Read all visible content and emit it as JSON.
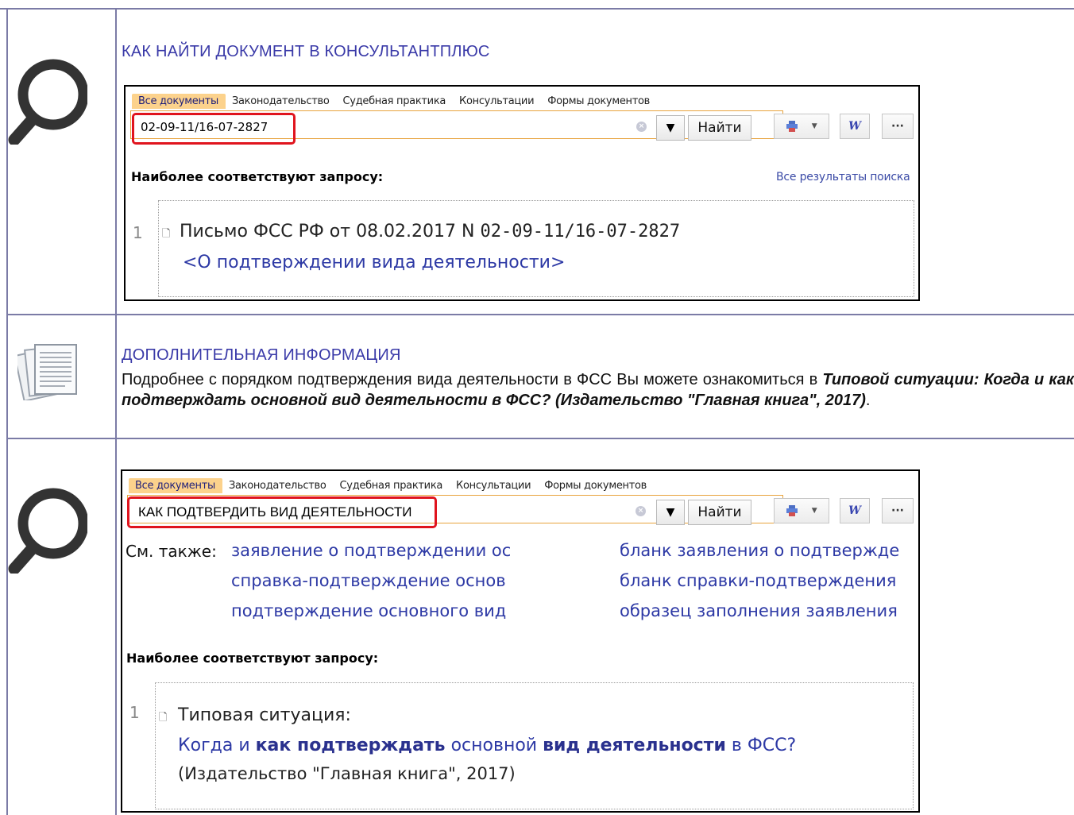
{
  "section1": {
    "heading": "КАК НАЙТИ ДОКУМЕНТ В КОНСУЛЬТАНТПЛЮС",
    "tabs": [
      "Все документы",
      "Законодательство",
      "Судебная практика",
      "Консультации",
      "Формы документов"
    ],
    "search_value": "02-09-11/16-07-2827",
    "find_label": "Найти",
    "most_relevant": "Наиболее соответствуют запросу:",
    "all_results": "Все результаты поиска",
    "result": {
      "number": "1",
      "title_prefix": "Письмо ФСС РФ от 08.02.2017 N ",
      "title_number": "02-09-11/16-07-2827",
      "subtitle": "<О подтверждении вида деятельности>"
    }
  },
  "section2": {
    "heading": "ДОПОЛНИТЕЛЬНАЯ ИНФОРМАЦИЯ",
    "text_plain": "Подробнее с порядком подтверждения вида деятельности в ФСС Вы можете ознакомиться в ",
    "text_italic": "Типовой ситуации: Когда и как подтверждать основной вид деятельности в ФСС? (Издательство \"Главная книга\", 2017)",
    "text_end": "."
  },
  "section3": {
    "tabs": [
      "Все документы",
      "Законодательство",
      "Судебная практика",
      "Консультации",
      "Формы документов"
    ],
    "search_value": "КАК ПОДТВЕРДИТЬ ВИД ДЕЯТЕЛЬНОСТИ",
    "find_label": "Найти",
    "see_also_label": "См. также:",
    "see_also": [
      "заявление о подтверждении ос",
      "справка-подтверждение основ",
      "подтверждение основного вид",
      "бланк заявления о подтвержде",
      "бланк справки-подтверждения",
      "образец заполнения заявления"
    ],
    "most_relevant": "Наиболее соответствуют запросу:",
    "result": {
      "number": "1",
      "title": "Типовая ситуация:",
      "link_1": "Когда и ",
      "link_2": "как подтверждать",
      "link_3": " основной ",
      "link_4": "вид деятельности",
      "link_5": " в ФСС?",
      "source": "(Издательство \"Главная книга\", 2017)"
    }
  },
  "icons": {
    "magnifier": "magnifier-icon",
    "documents": "documents-icon",
    "printer": "printer-icon",
    "word": "word-icon",
    "more": "more-icon",
    "dropdown": "chevron-down-icon",
    "clear": "clear-icon",
    "doc": "document-icon"
  },
  "colors": {
    "heading": "#3a3aa8",
    "active_tab": "#fcd28c",
    "link": "#2d39a5",
    "highlight": "#e0141e"
  }
}
